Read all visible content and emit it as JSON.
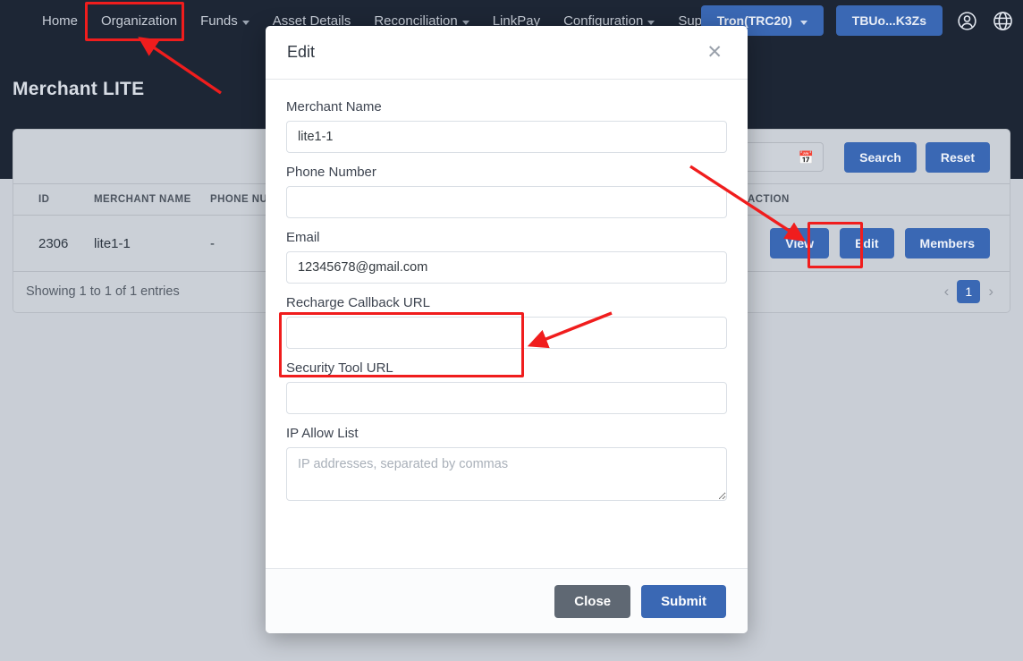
{
  "navbar": {
    "links": [
      {
        "label": "Home",
        "caret": false
      },
      {
        "label": "Organization",
        "caret": false
      },
      {
        "label": "Funds",
        "caret": true
      },
      {
        "label": "Asset Details",
        "caret": false
      },
      {
        "label": "Reconciliation",
        "caret": true
      },
      {
        "label": "LinkPay",
        "caret": false
      },
      {
        "label": "Configuration",
        "caret": true
      },
      {
        "label": "Support",
        "caret": false
      }
    ],
    "network_button": "Tron(TRC20)",
    "wallet_button": "TBUo...K3Zs",
    "account_icon": "user-circle-icon",
    "language_icon": "globe-icon"
  },
  "header": {
    "title": "Merchant LITE"
  },
  "filters": {
    "date_value": "",
    "date_icon": "calendar-icon",
    "search_label": "Search",
    "reset_label": "Reset"
  },
  "table": {
    "columns": [
      "ID",
      "MERCHANT NAME",
      "PHONE NUMBER",
      "",
      "",
      "ACTION"
    ],
    "rows": [
      {
        "id": "2306",
        "merchant_name": "lite1-1",
        "phone_number": "-",
        "col4": "",
        "col5": "",
        "actions": [
          "View",
          "Edit",
          "Members"
        ]
      }
    ],
    "entries_text": "Showing 1 to 1 of 1 entries",
    "pagination": {
      "prev": "‹",
      "next": "›",
      "pages": [
        "1"
      ],
      "current": "1"
    }
  },
  "modal": {
    "title": "Edit",
    "close_icon": "close-icon",
    "fields": [
      {
        "label": "Merchant Name",
        "value": "lite1-1",
        "placeholder": "",
        "type": "input"
      },
      {
        "label": "Phone Number",
        "value": "",
        "placeholder": "",
        "type": "input"
      },
      {
        "label": "Email",
        "value": "12345678@gmail.com",
        "placeholder": "",
        "type": "input"
      },
      {
        "label": "Recharge Callback URL",
        "value": "",
        "placeholder": "",
        "type": "input"
      },
      {
        "label": "Security Tool URL",
        "value": "",
        "placeholder": "",
        "type": "input"
      },
      {
        "label": "IP Allow List",
        "value": "",
        "placeholder": "IP addresses, separated by commas",
        "type": "textarea"
      }
    ],
    "close_label": "Close",
    "submit_label": "Submit"
  },
  "annotations": {
    "color": "#f01d1d",
    "boxes": [
      {
        "name": "organization-nav-highlight"
      },
      {
        "name": "edit-button-highlight"
      },
      {
        "name": "recharge-callback-url-highlight"
      }
    ],
    "arrows": [
      {
        "name": "arrow-to-organization"
      },
      {
        "name": "arrow-to-edit-button"
      },
      {
        "name": "arrow-to-recharge-callback"
      }
    ]
  },
  "colors": {
    "nav_bg": "#1d2635",
    "accent_blue": "#3a68b4",
    "page_bg": "#c9ced6",
    "grey_button": "#5f6873",
    "annotation_red": "#f01d1d"
  }
}
